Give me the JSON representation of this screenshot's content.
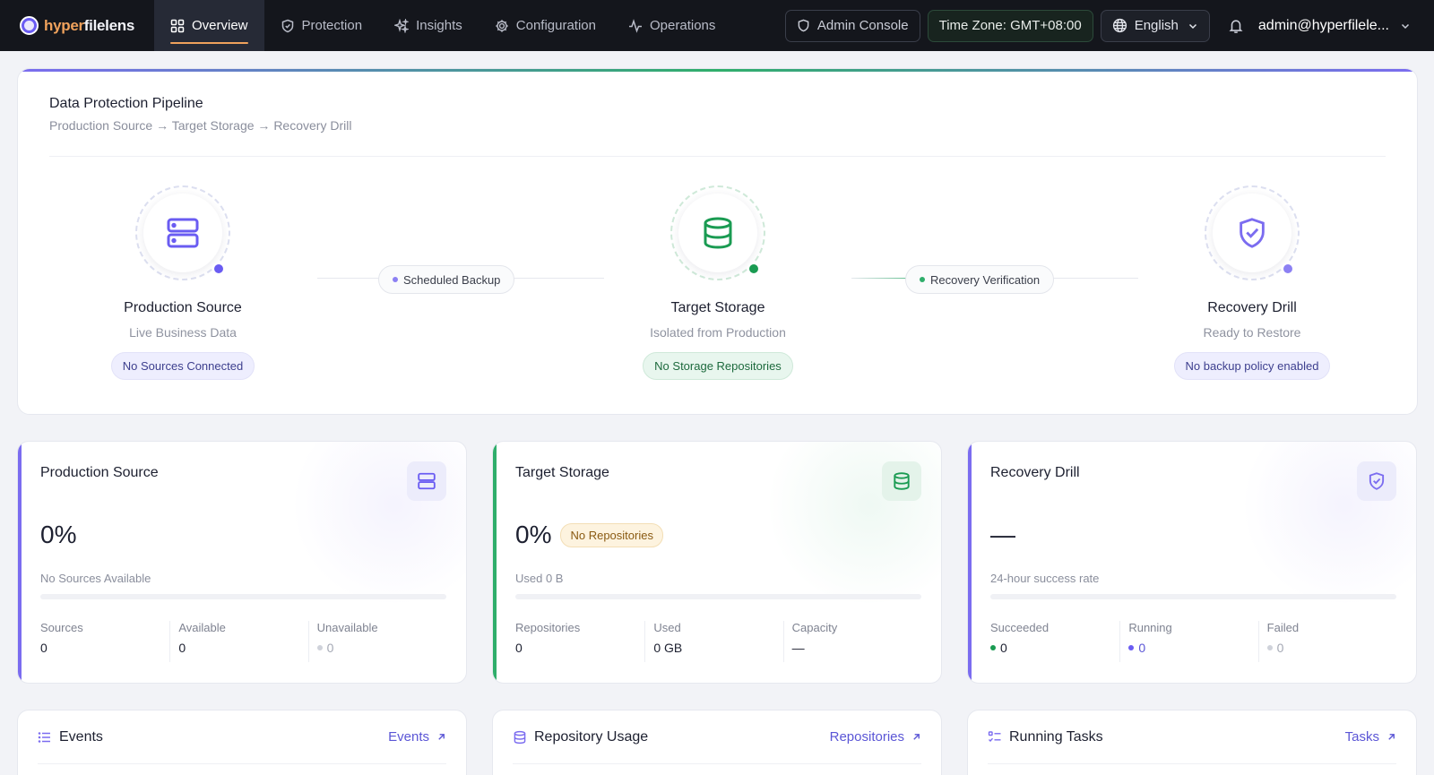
{
  "brand": {
    "part1": "hyper",
    "part2": "filelens"
  },
  "nav": [
    {
      "label": "Overview",
      "icon": "grid-icon",
      "active": true
    },
    {
      "label": "Protection",
      "icon": "shield-icon"
    },
    {
      "label": "Insights",
      "icon": "sparkles-icon"
    },
    {
      "label": "Configuration",
      "icon": "gear-icon"
    },
    {
      "label": "Operations",
      "icon": "activity-icon"
    }
  ],
  "header": {
    "admin_console": "Admin Console",
    "timezone": "Time Zone: GMT+08:00",
    "language": "English",
    "user": "admin@hyperfilele..."
  },
  "pipeline": {
    "title": "Data Protection Pipeline",
    "subtitle": "Production Source → Target Storage → Recovery Drill",
    "stages": [
      {
        "name": "Production Source",
        "desc": "Live Business Data",
        "badge": "No Sources Connected",
        "icon": "server-icon",
        "color": "#6a5cf2"
      },
      {
        "name": "Target Storage",
        "desc": "Isolated from Production",
        "badge": "No Storage Repositories",
        "icon": "database-icon",
        "color": "#1a9b52"
      },
      {
        "name": "Recovery Drill",
        "desc": "Ready to Restore",
        "badge": "No backup policy enabled",
        "icon": "shield-check-icon",
        "color": "#8c80f3"
      }
    ],
    "connectors": [
      {
        "label": "Scheduled Backup",
        "color": "#8c80f3"
      },
      {
        "label": "Recovery Verification",
        "color": "#2fae6b"
      }
    ]
  },
  "stats": {
    "production": {
      "title": "Production Source",
      "value": "0%",
      "caption": "No Sources Available",
      "progress": 0,
      "cols": [
        {
          "label": "Sources",
          "value": "0"
        },
        {
          "label": "Available",
          "value": "0"
        },
        {
          "label": "Unavailable",
          "value": "0"
        }
      ]
    },
    "storage": {
      "title": "Target Storage",
      "value": "0%",
      "tag": "No Repositories",
      "caption": "Used 0 B",
      "progress": 0,
      "cols": [
        {
          "label": "Repositories",
          "value": "0"
        },
        {
          "label": "Used",
          "value": "0 GB"
        },
        {
          "label": "Capacity",
          "value": "—"
        }
      ]
    },
    "recovery": {
      "title": "Recovery Drill",
      "value": "—",
      "caption": "24-hour success rate",
      "progress": 0,
      "cols": [
        {
          "label": "Succeeded",
          "value": "0"
        },
        {
          "label": "Running",
          "value": "0"
        },
        {
          "label": "Failed",
          "value": "0"
        }
      ]
    }
  },
  "bottom": [
    {
      "title": "Events",
      "link": "Events",
      "icon": "list-icon"
    },
    {
      "title": "Repository Usage",
      "link": "Repositories",
      "icon": "database-icon"
    },
    {
      "title": "Running Tasks",
      "link": "Tasks",
      "icon": "tasks-icon"
    }
  ],
  "colors": {
    "accent": "#6a5cf2",
    "success": "#1a9b52",
    "brand_orange": "#f0a25c",
    "topbar": "#14161c"
  }
}
